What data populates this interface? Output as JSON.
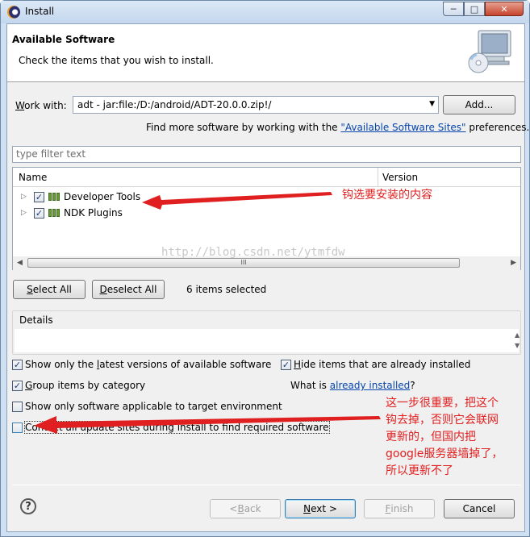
{
  "window": {
    "title": "Install",
    "controls": {
      "minimize": "─",
      "maximize": "□",
      "close": "✕"
    }
  },
  "banner": {
    "title": "Available Software",
    "description": "Check the items that you wish to install.",
    "image_icon": "install-wizard-icon"
  },
  "work_with": {
    "label_prefix": "",
    "label_mnemonic": "W",
    "label_rest": "ork with:",
    "value": "adt - jar:file:/D:/android/ADT-20.0.0.zip!/",
    "add_button": "Add...",
    "find_more_prefix": "Find more software by working with the ",
    "find_more_link": "\"Available Software Sites\"",
    "find_more_suffix": " preferences."
  },
  "filter": {
    "placeholder": "type filter text"
  },
  "tree": {
    "columns": [
      "Name",
      "Version"
    ],
    "rows": [
      {
        "label": "Developer Tools",
        "version": "",
        "checked": true
      },
      {
        "label": "NDK Plugins",
        "version": "",
        "checked": true
      }
    ],
    "scroll_grip": "III"
  },
  "selection": {
    "select_all_mnemonic": "S",
    "select_all_rest": "elect All",
    "deselect_all_mnemonic": "D",
    "deselect_all_rest": "eselect All",
    "status": "6 items selected"
  },
  "details": {
    "label": "Details"
  },
  "options": {
    "latest": {
      "pre": "Show only the ",
      "mn": "l",
      "post": "atest versions of available software",
      "checked": true
    },
    "hide": {
      "pre": "",
      "mn": "H",
      "post": "ide items that are already installed",
      "checked": true
    },
    "group": {
      "pre": "",
      "mn": "G",
      "post": "roup items by category",
      "checked": true
    },
    "whatis_prefix": "What is ",
    "whatis_link": "already installed",
    "whatis_suffix": "?",
    "target": {
      "pre": "Show only software applicable to target environment",
      "checked": false
    },
    "contact": {
      "pre": "Contact all update sites during install to find required software",
      "checked": false
    }
  },
  "buttons": {
    "back_pre": "< ",
    "back_mn": "B",
    "back_post": "ack",
    "next_mn": "N",
    "next_post": "ext >",
    "finish_mn": "F",
    "finish_post": "inish",
    "cancel": "Cancel"
  },
  "annotations": {
    "note1": "钩选要安装的内容",
    "note2_lines": [
      "这一步很重要，把这个",
      "钩去掉，否则它会联网",
      "更新的，但国内把",
      "google服务器墙掉了，",
      "所以更新不了"
    ],
    "watermark": "http://blog.csdn.net/ytmfdw",
    "color": "#e02020"
  },
  "help_icon": "help-icon"
}
